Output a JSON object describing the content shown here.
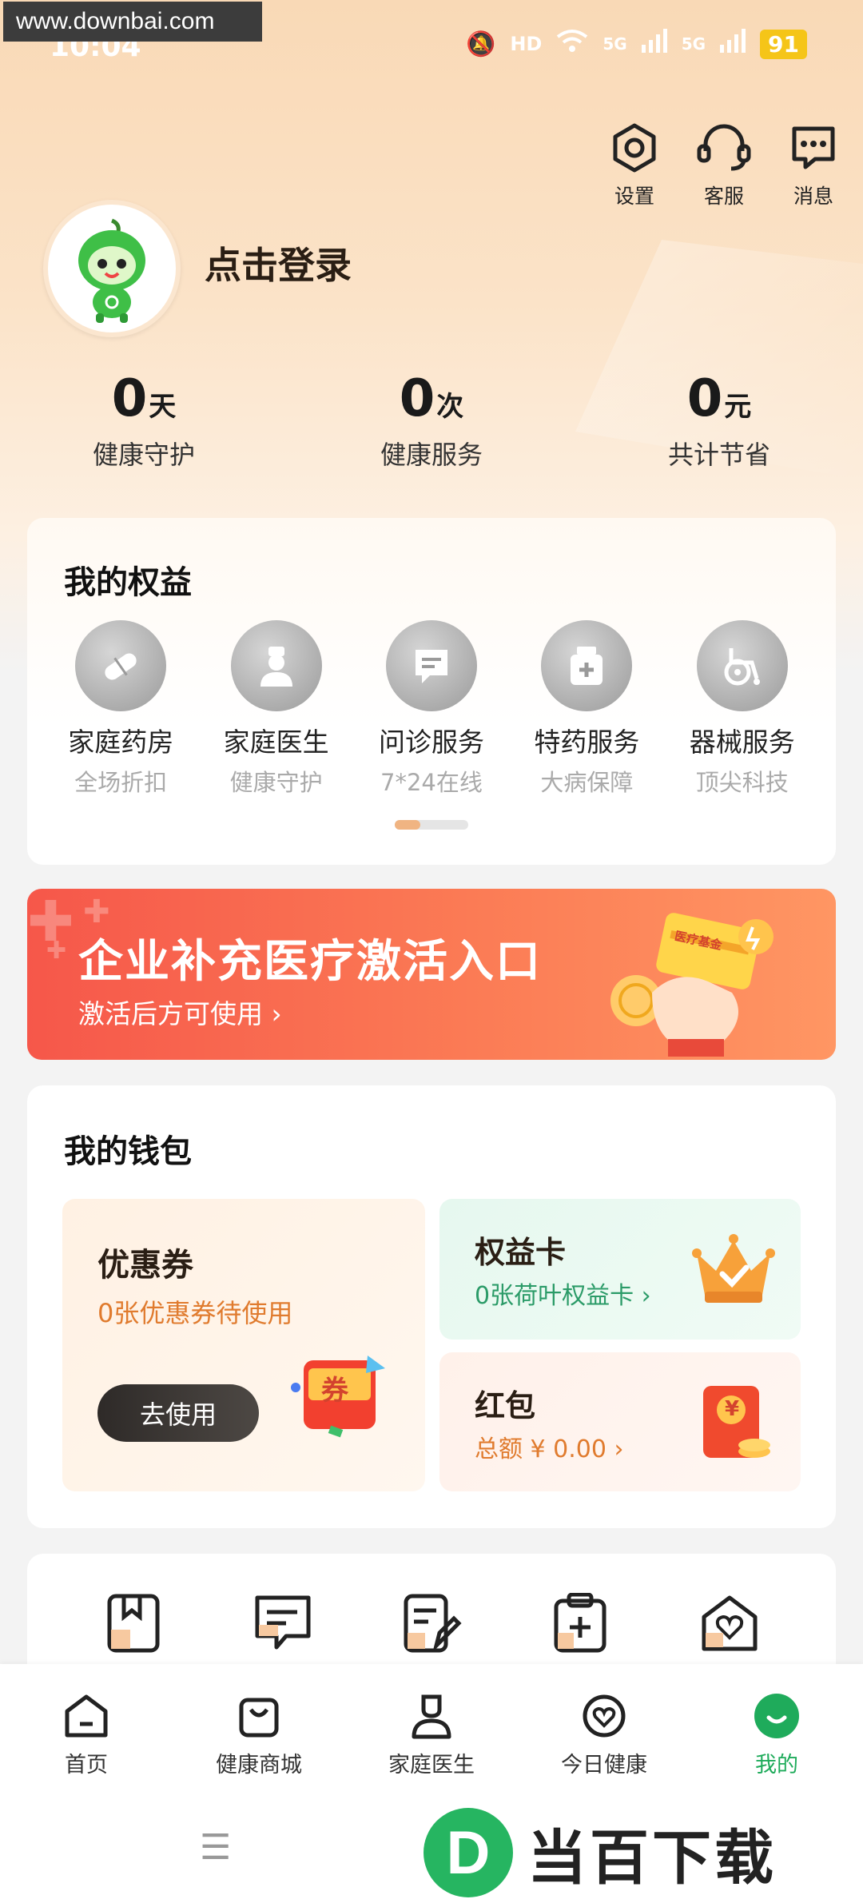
{
  "status_bar": {
    "watermark_url": "www.downbai.com",
    "time": "10:04",
    "network": "5G",
    "battery": "91"
  },
  "header": {
    "settings_label": "设置",
    "service_label": "客服",
    "messages_label": "消息"
  },
  "profile": {
    "login_text": "点击登录"
  },
  "stats": [
    {
      "value": "0",
      "unit": "天",
      "label": "健康守护"
    },
    {
      "value": "0",
      "unit": "次",
      "label": "健康服务"
    },
    {
      "value": "0",
      "unit": "元",
      "label": "共计节省"
    }
  ],
  "rights": {
    "title": "我的权益",
    "items": [
      {
        "label": "家庭药房",
        "sub": "全场折扣",
        "icon": "pill-icon"
      },
      {
        "label": "家庭医生",
        "sub": "健康守护",
        "icon": "doctor-icon"
      },
      {
        "label": "问诊服务",
        "sub": "7*24在线",
        "icon": "chat-icon"
      },
      {
        "label": "特药服务",
        "sub": "大病保障",
        "icon": "medicine-box-icon"
      },
      {
        "label": "器械服务",
        "sub": "顶尖科技",
        "icon": "wheelchair-icon"
      }
    ],
    "page_index": 1,
    "page_count": 2
  },
  "banner": {
    "title": "企业补充医疗激活入口",
    "subtitle": "激活后方可使用",
    "card_text": "医疗基金"
  },
  "wallet": {
    "title": "我的钱包",
    "coupon": {
      "title": "优惠券",
      "sub": "0张优惠券待使用",
      "button": "去使用",
      "art_text": "券"
    },
    "rights_card": {
      "title": "权益卡",
      "sub": "0张荷叶权益卡"
    },
    "red_packet": {
      "title": "红包",
      "sub": "总额 ¥ 0.00",
      "art_text": "¥"
    }
  },
  "bottom_nav": [
    {
      "label": "首页",
      "icon": "home-icon"
    },
    {
      "label": "健康商城",
      "icon": "shopping-bag-icon"
    },
    {
      "label": "家庭医生",
      "icon": "doctor-icon"
    },
    {
      "label": "今日健康",
      "icon": "heart-icon"
    },
    {
      "label": "我的",
      "icon": "profile-icon",
      "active": true
    }
  ],
  "brand_watermark": {
    "logo_letter": "D",
    "text": "当百下载"
  },
  "colors": {
    "accent_green": "#1fab5b",
    "orange": "#e07b2e",
    "banner_red": "#f6574a"
  }
}
